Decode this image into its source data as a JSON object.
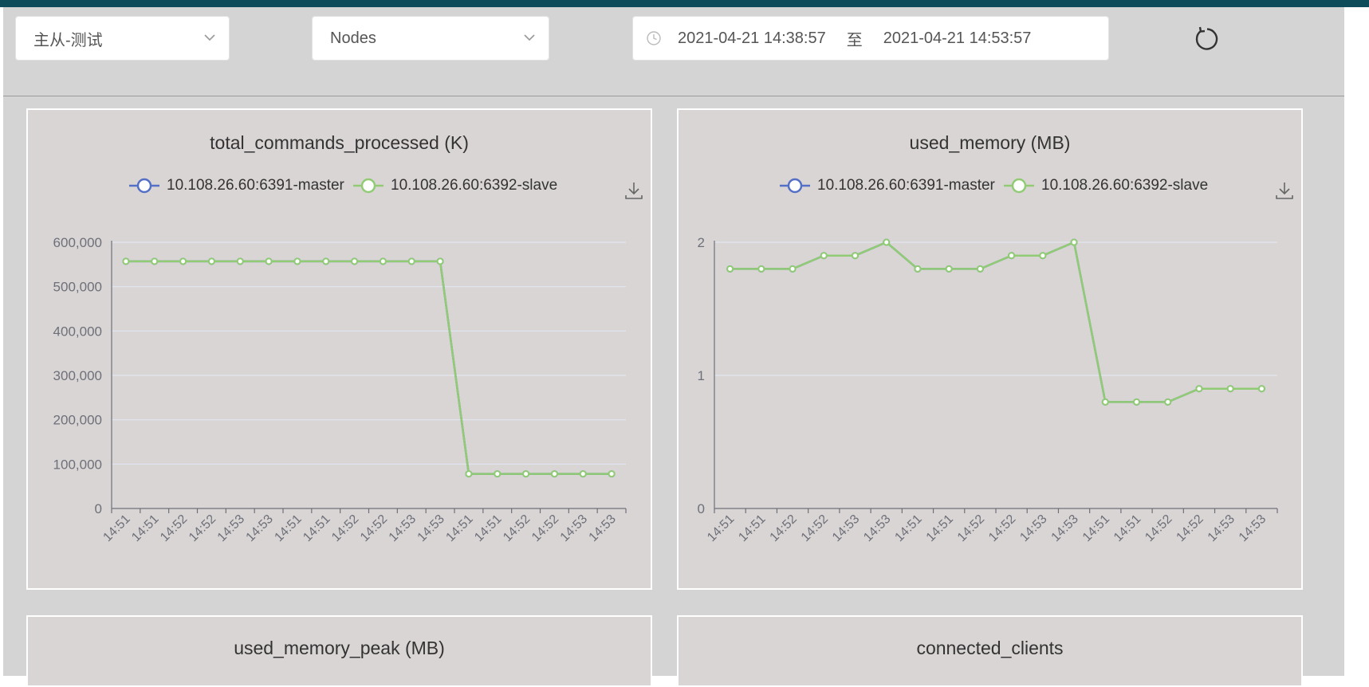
{
  "filters": {
    "cluster": "主从-测试",
    "node_type": "Nodes",
    "time_start": "2021-04-21 14:38:57",
    "time_sep": "至",
    "time_end": "2021-04-21 14:53:57"
  },
  "icons": {
    "clock": "clock-icon",
    "chevron": "chevron-down-icon",
    "refresh": "refresh-icon",
    "download": "download-icon"
  },
  "colors": {
    "master": "#5470c6",
    "slave": "#91cc75",
    "axis": "#6e7079",
    "grid": "#e0e6f1"
  },
  "chart_data": [
    {
      "type": "line",
      "title": "total_commands_processed (K)",
      "series_names": [
        "10.108.26.60:6391-master",
        "10.108.26.60:6392-slave"
      ],
      "x": [
        "14:51",
        "14:51",
        "14:52",
        "14:52",
        "14:53",
        "14:53",
        "14:51",
        "14:51",
        "14:52",
        "14:52",
        "14:53",
        "14:53",
        "14:51",
        "14:51",
        "14:52",
        "14:52",
        "14:53",
        "14:53"
      ],
      "series": [
        {
          "name": "10.108.26.60:6391-master",
          "values": [
            557000,
            557000,
            557000,
            557000,
            557000,
            557000,
            557000,
            557000,
            557000,
            557000,
            557000,
            557000,
            78000,
            78000,
            78000,
            78000,
            78000,
            78000
          ]
        },
        {
          "name": "10.108.26.60:6392-slave",
          "values": [
            557000,
            557000,
            557000,
            557000,
            557000,
            557000,
            557000,
            557000,
            557000,
            557000,
            557000,
            557000,
            78000,
            78000,
            78000,
            78000,
            78000,
            78000
          ]
        }
      ],
      "ylim": [
        0,
        600000
      ],
      "yticks": [
        0,
        100000,
        200000,
        300000,
        400000,
        500000,
        600000
      ],
      "ytick_labels": [
        "0",
        "100,000",
        "200,000",
        "300,000",
        "400,000",
        "500,000",
        "600,000"
      ]
    },
    {
      "type": "line",
      "title": "used_memory (MB)",
      "series_names": [
        "10.108.26.60:6391-master",
        "10.108.26.60:6392-slave"
      ],
      "x": [
        "14:51",
        "14:51",
        "14:52",
        "14:52",
        "14:53",
        "14:53",
        "14:51",
        "14:51",
        "14:52",
        "14:52",
        "14:53",
        "14:53",
        "14:51",
        "14:51",
        "14:52",
        "14:52",
        "14:53",
        "14:53"
      ],
      "series": [
        {
          "name": "10.108.26.60:6391-master",
          "values": [
            1.8,
            1.8,
            1.8,
            1.9,
            1.9,
            2.0,
            1.8,
            1.8,
            1.8,
            1.9,
            1.9,
            2.0,
            0.8,
            0.8,
            0.8,
            0.9,
            0.9,
            0.9
          ]
        },
        {
          "name": "10.108.26.60:6392-slave",
          "values": [
            1.8,
            1.8,
            1.8,
            1.9,
            1.9,
            2.0,
            1.8,
            1.8,
            1.8,
            1.9,
            1.9,
            2.0,
            0.8,
            0.8,
            0.8,
            0.9,
            0.9,
            0.9
          ]
        }
      ],
      "ylim": [
        0,
        2
      ],
      "yticks": [
        0,
        1,
        2
      ],
      "ytick_labels": [
        "0",
        "1",
        "2"
      ]
    },
    {
      "type": "line",
      "title": "used_memory_peak (MB)"
    },
    {
      "type": "line",
      "title": "connected_clients"
    }
  ]
}
